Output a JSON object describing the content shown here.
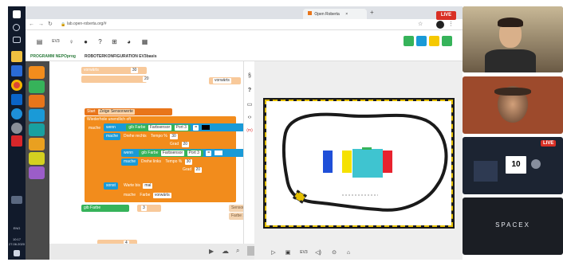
{
  "taskbar": {
    "clock_time": "10:17",
    "clock_date": "27.06.2020",
    "lang": "ENG",
    "icons": [
      "windows-icon",
      "search-icon",
      "task-view-icon",
      "file-explorer-icon",
      "store-icon",
      "chrome-icon",
      "mail-icon",
      "edge-icon",
      "settings-icon",
      "acrobat-icon",
      "files-icon"
    ]
  },
  "browser": {
    "tab1_title": "Open Roberta",
    "url": "lab.open-roberta.org/#",
    "live_badge": "LIVE"
  },
  "robot_label": "EV3",
  "subtabs": {
    "program": "PROGRAMM NEPOprog",
    "config": "ROBOTERKONFIGURATION EV3basis"
  },
  "blocks": {
    "top1": "vorwärts",
    "top1_val": "30",
    "top2_val": "20",
    "right_block": "vorwärts",
    "start": "Start",
    "start_var": "Zeige Sensorwerte",
    "loop": "Wiederhole unendlich oft",
    "mache": "mache",
    "wenn": "wenn",
    "farbe": "gib Farbe",
    "farbsensor": "Farbsensor",
    "port3": "Port 3",
    "gleich": "=",
    "motor_rechts": "Drehe rechts",
    "tempo": "Tempo %",
    "val30": "30",
    "grad": "Grad",
    "val20": "20",
    "motor_links": "Drehe links",
    "sonst": "sonst",
    "warte": "Warte bis",
    "warte_val": "mal",
    "farbe2": "Farbe",
    "farbe_val": "vorwärts",
    "bottom_gib": "gib Farbe",
    "bottom_val": "3",
    "lp1": "Sensorbeschreibung",
    "lp2": "Farbe setzen",
    "bottom_num1": "4",
    "bottom_num2": "30",
    "toolstrip_badge1": "3",
    "toolstrip_badge2": "(m)"
  },
  "sim_toolbar": [
    "play-icon",
    "image-icon",
    "EV3",
    "sound-icon",
    "location-icon",
    "home-icon"
  ],
  "participants": [
    {
      "name": "participant-1"
    },
    {
      "name": "participant-2"
    },
    {
      "name": "participant-3",
      "badge": "LIVE",
      "screen_text": "10"
    },
    {
      "name": "participant-4",
      "text": "SPACEX"
    }
  ],
  "colors": {
    "blocks_orange": "#f28c1c",
    "blocks_green": "#36b35a",
    "blocks_blue": "#1a9ad7",
    "track": "#1a1a1a",
    "red_block": "#e8222e",
    "blue_block": "#1f4fd8",
    "yellow_block": "#f5e100",
    "cyan_block": "#3fc4d0"
  }
}
